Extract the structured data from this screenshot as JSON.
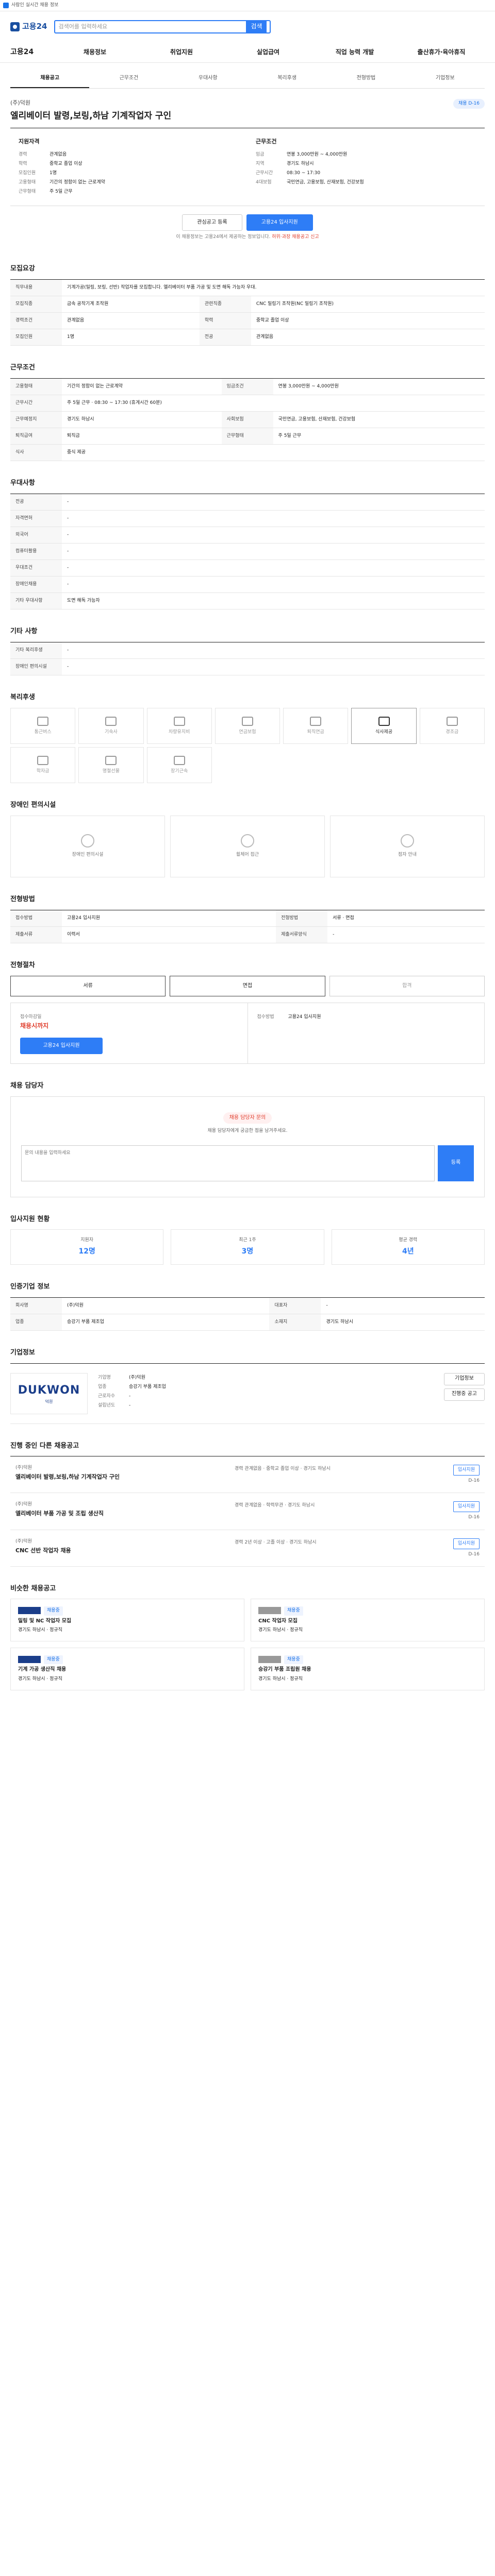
{
  "topbar": {
    "text": "사람인 실시간 채용 정보"
  },
  "header": {
    "logo": "고용24",
    "search_placeholder": "검색어를 입력하세요",
    "search_label": "검색"
  },
  "nav": {
    "all": "고용24",
    "items": [
      "채용정보",
      "취업지원",
      "실업급여",
      "직업 능력 개발",
      "출산휴가·육아휴직"
    ]
  },
  "tabs": [
    "채용공고",
    "근무조건",
    "우대사항",
    "복리후생",
    "전형방법",
    "기업정보"
  ],
  "posting": {
    "company": "(주)덕원",
    "title": "엘리베이터 발령,보링,하남 기계작업자 구인",
    "badge": "채용 D-16"
  },
  "summary": {
    "left_title": "지원자격",
    "left": [
      {
        "k": "경력",
        "v": "관계없음"
      },
      {
        "k": "학력",
        "v": "중학교 졸업 이상"
      },
      {
        "k": "모집인원",
        "v": "1명"
      },
      {
        "k": "고용형태",
        "v": "기간의 정함이 없는 근로계약"
      },
      {
        "k": "근무형태",
        "v": "주 5일 근무"
      }
    ],
    "right_title": "근무조건",
    "right": [
      {
        "k": "임금",
        "v": "연봉 3,000만원 ~ 4,000만원"
      },
      {
        "k": "지역",
        "v": "경기도 하남시"
      },
      {
        "k": "근무시간",
        "v": "08:30 ~ 17:30"
      },
      {
        "k": "4대보험",
        "v": "국민연금, 고용보험, 산재보험, 건강보험"
      }
    ]
  },
  "actions": {
    "scrap": "관심공고 등록",
    "apply": "고용24 입사지원"
  },
  "note": {
    "text": "이 채용정보는 고용24에서 제공하는 정보입니다.",
    "warn": "허위·과장 채용공고 신고"
  },
  "recruit": {
    "title": "모집요강",
    "rows": [
      {
        "k": "직무내용",
        "v": "기계가공(밀링, 보링, 선반) 작업자를 모집합니다. 엘리베이터 부품 가공 및 도면 해독 가능자 우대."
      },
      {
        "k": "모집직종",
        "v": "금속 공작기계 조작원"
      },
      {
        "k": "관련직종",
        "v": "CNC 밀링기 조작원(NC 밀링기 조작원)"
      },
      {
        "k": "경력조건",
        "v": "관계없음"
      },
      {
        "k": "학력",
        "v": "중학교 졸업 이상"
      },
      {
        "k": "모집인원",
        "v": "1명"
      },
      {
        "k": "전공",
        "v": "관계없음"
      }
    ]
  },
  "conditions": {
    "title": "근무조건",
    "rows": [
      {
        "k": "고용형태",
        "v": "기간의 정함이 없는 근로계약"
      },
      {
        "k": "임금조건",
        "v": "연봉 3,000만원 ~ 4,000만원"
      },
      {
        "k": "근무시간",
        "v": "주 5일 근무 · 08:30 ~ 17:30 (휴게시간 60분)"
      },
      {
        "k": "근무예정지",
        "v": "경기도 하남시"
      },
      {
        "k": "사회보험",
        "v": "국민연금, 고용보험, 산재보험, 건강보험"
      },
      {
        "k": "퇴직급여",
        "v": "퇴직금"
      },
      {
        "k": "근무형태",
        "v": "주 5일 근무"
      },
      {
        "k": "식사",
        "v": "중식 제공"
      }
    ]
  },
  "preference": {
    "title": "우대사항",
    "rows": [
      {
        "k": "전공",
        "v": "-"
      },
      {
        "k": "자격면허",
        "v": "-"
      },
      {
        "k": "외국어",
        "v": "-"
      },
      {
        "k": "컴퓨터활용",
        "v": "-"
      },
      {
        "k": "우대조건",
        "v": "-"
      },
      {
        "k": "장애인채용",
        "v": "-"
      },
      {
        "k": "기타 우대사항",
        "v": "도면 해독 가능자"
      }
    ]
  },
  "other": {
    "title": "기타 사항",
    "rows": [
      {
        "k": "기타 복리후생",
        "v": "-"
      },
      {
        "k": "장애인 편의시설",
        "v": "-"
      }
    ]
  },
  "welfare": {
    "title": "복리후생",
    "items": [
      "통근버스",
      "기숙사",
      "차량유지비",
      "연금보험",
      "퇴직연금",
      "식사제공",
      "경조금",
      "학자금",
      "명절선물",
      "장기근속"
    ],
    "active_index": 5
  },
  "disability": {
    "title": "장애인 편의시설",
    "items": [
      "장애인 편의시설",
      "휠체어 접근",
      "점자 안내"
    ]
  },
  "selection": {
    "title": "전형방법",
    "rows": [
      {
        "k": "접수방법",
        "v": "고용24 입사지원"
      },
      {
        "k": "전형방법",
        "v": "서류 · 면접"
      },
      {
        "k": "제출서류",
        "v": "이력서"
      },
      {
        "k": "제출서류양식",
        "v": "-"
      }
    ]
  },
  "process": {
    "title": "전형절차",
    "steps": [
      "서류",
      "면접",
      "합격"
    ]
  },
  "apply": {
    "deadline_label": "접수마감일",
    "deadline": "채용시까지",
    "method_label": "접수방법",
    "method": "고용24 입사지원",
    "button": "고용24 입사지원"
  },
  "qa": {
    "title": "채용 담당자",
    "pill": "채용 담당자 문의",
    "desc": "채용 담당자에게 궁금한 점을 남겨주세요.",
    "placeholder": "문의 내용을 입력하세요",
    "send": "등록"
  },
  "stats": {
    "title": "입사지원 현황",
    "items": [
      {
        "label": "지원자",
        "value": "12명"
      },
      {
        "label": "최근 1주",
        "value": "3명"
      },
      {
        "label": "평균 경력",
        "value": "4년"
      }
    ]
  },
  "contact": {
    "title": "인증기업 정보",
    "rows": [
      {
        "k": "회사명",
        "v": "(주)덕원"
      },
      {
        "k": "대표자",
        "v": "-"
      },
      {
        "k": "업종",
        "v": "승강기 부품 제조업"
      },
      {
        "k": "소재지",
        "v": "경기도 하남시"
      }
    ]
  },
  "company": {
    "title": "기업정보",
    "logo_text": "DUKWON",
    "logo_sub": "덕원",
    "rows": [
      {
        "k": "기업명",
        "v": "(주)덕원"
      },
      {
        "k": "업종",
        "v": "승강기 부품 제조업"
      },
      {
        "k": "근로자수",
        "v": "-"
      },
      {
        "k": "설립년도",
        "v": "-"
      }
    ],
    "btn1": "기업정보",
    "btn2": "진행중 공고"
  },
  "jobs": {
    "title": "진행 중인 다른 채용공고",
    "items": [
      {
        "name": "(주)덕원",
        "title": "엘리베이터 발령,보링,하남 기계작업자 구인",
        "meta": "경력 관계없음 · 중학교 졸업 이상 · 경기도 하남시",
        "apply": "입사지원",
        "dday": "D-16"
      },
      {
        "name": "(주)덕원",
        "title": "엘리베이터 부품 가공 및 조립 생산직",
        "meta": "경력 관계없음 · 학력무관 · 경기도 하남시",
        "apply": "입사지원",
        "dday": "D-16"
      },
      {
        "name": "(주)덕원",
        "title": "CNC 선반 작업자 채용",
        "meta": "경력 2년 이상 · 고졸 이상 · 경기도 하남시",
        "apply": "입사지원",
        "dday": "D-16"
      }
    ]
  },
  "recommend": {
    "title": "비슷한 채용공고",
    "items": [
      {
        "tag": "채용중",
        "title": "밀링 및 NC 작업자 모집",
        "meta": "경기도 하남시 · 정규직"
      },
      {
        "tag": "채용중",
        "title": "CNC 작업자 모집",
        "meta": "경기도 하남시 · 정규직"
      },
      {
        "tag": "채용중",
        "title": "기계 가공 생산직 채용",
        "meta": "경기도 하남시 · 정규직"
      },
      {
        "tag": "채용중",
        "title": "승강기 부품 조립원 채용",
        "meta": "경기도 하남시 · 정규직"
      }
    ]
  }
}
